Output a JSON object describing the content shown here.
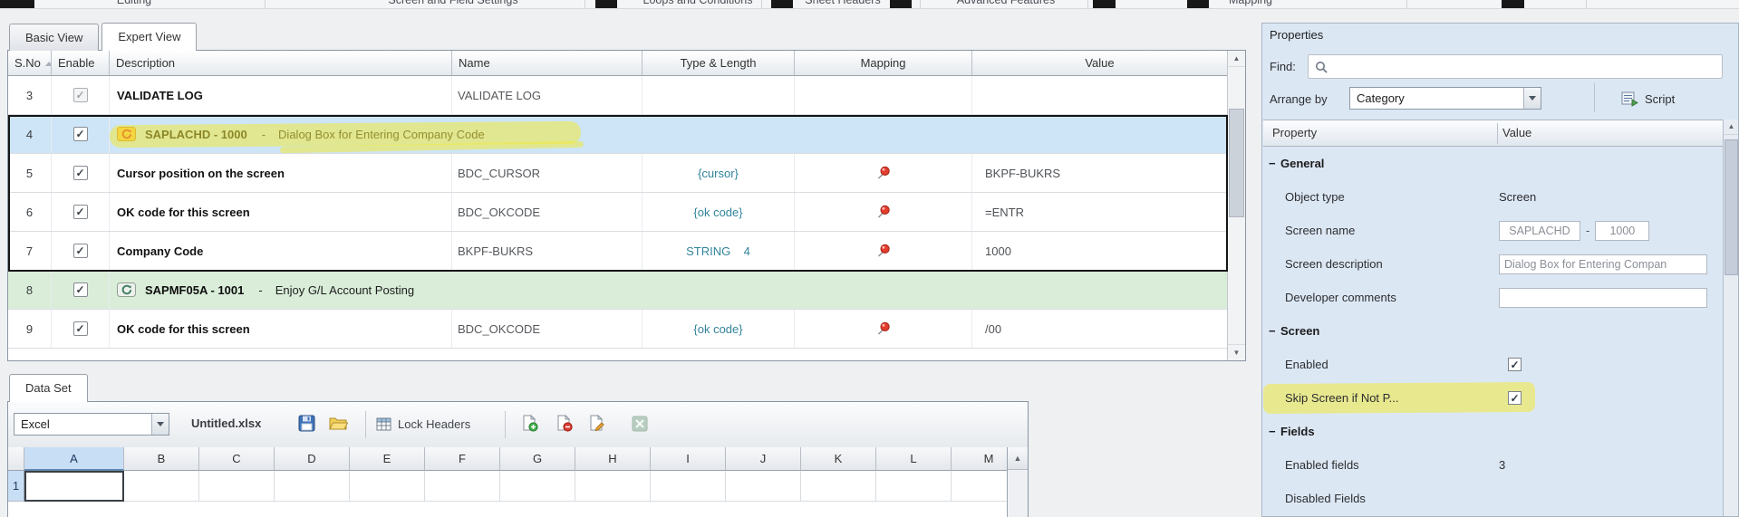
{
  "colors": {
    "accent_teal": "#31849b",
    "selected_row": "#cde5f6",
    "screen_row": "#d9edd9",
    "highlight_yellow": "#f3e93c",
    "pin_red": "#e23d2e"
  },
  "ribbon": {
    "groups": [
      "Editing",
      "Screen and Field Settings",
      "Loops and Conditions",
      "Sheet Headers",
      "Advanced Features",
      "Mapping"
    ]
  },
  "view_tabs": [
    {
      "label": "Basic View",
      "active": false
    },
    {
      "label": "Expert View",
      "active": true
    }
  ],
  "script_table": {
    "columns": [
      "S.No",
      "Enable",
      "Description",
      "Name",
      "Type & Length",
      "Mapping",
      "Value"
    ],
    "rows": [
      {
        "sno": "3",
        "checked": true,
        "check_gray": true,
        "kind": "normal",
        "description": "VALIDATE LOG",
        "name": "VALIDATE LOG",
        "type": "",
        "mapped": false,
        "value": ""
      },
      {
        "sno": "4",
        "checked": true,
        "kind": "screen-selected",
        "icon": "screen-icon-orange",
        "code": "SAPLACHD - 1000",
        "sep": "-",
        "text": "Dialog Box for Entering Company Code",
        "highlighted": true
      },
      {
        "sno": "5",
        "checked": true,
        "kind": "normal",
        "description": "Cursor position on the screen",
        "name": "BDC_CURSOR",
        "type": "{cursor}",
        "mapped": true,
        "value": "BKPF-BUKRS"
      },
      {
        "sno": "6",
        "checked": true,
        "kind": "normal",
        "description": "OK code for this screen",
        "name": "BDC_OKCODE",
        "type": "{ok code}",
        "mapped": true,
        "value": "=ENTR"
      },
      {
        "sno": "7",
        "checked": true,
        "kind": "normal",
        "description": "Company Code",
        "name": "BKPF-BUKRS",
        "type": "STRING    4",
        "mapped": true,
        "value": "1000"
      },
      {
        "sno": "8",
        "checked": true,
        "kind": "screen-green",
        "icon": "screen-icon-green",
        "code": "SAPMF05A - 1001",
        "sep": "-",
        "text": "Enjoy G/L Account Posting"
      },
      {
        "sno": "9",
        "checked": true,
        "kind": "normal",
        "description": "OK code for this screen",
        "name": "BDC_OKCODE",
        "type": "{ok code}",
        "mapped": true,
        "value": "/00"
      }
    ]
  },
  "dataset": {
    "tab_label": "Data Set",
    "source": "Excel",
    "file_name": "Untitled.xlsx",
    "lock_headers": "Lock Headers",
    "toolbar_icons": [
      "save-icon",
      "open-file-icon",
      "lock-headers-icon",
      "add-sheet-icon",
      "remove-sheet-icon",
      "rename-sheet-icon",
      "excel-icon"
    ],
    "columns": [
      "A",
      "B",
      "C",
      "D",
      "E",
      "F",
      "G",
      "H",
      "I",
      "J",
      "K",
      "L",
      "M"
    ],
    "row_labels": [
      "1"
    ]
  },
  "properties": {
    "title": "Properties",
    "find_label": "Find:",
    "arrange_label": "Arrange by",
    "arrange_value": "Category",
    "script_label": "Script",
    "grid_header": {
      "property": "Property",
      "value": "Value"
    },
    "groups": [
      {
        "label": "General",
        "items": [
          {
            "label": "Object type",
            "kind": "text",
            "value": "Screen"
          },
          {
            "label": "Screen name",
            "kind": "dual",
            "value1": "SAPLACHD",
            "sep": "-",
            "value2": "1000"
          },
          {
            "label": "Screen description",
            "kind": "input",
            "value": "Dialog Box for Entering Compan"
          },
          {
            "label": "Developer comments",
            "kind": "input",
            "value": ""
          }
        ]
      },
      {
        "label": "Screen",
        "items": [
          {
            "label": "Enabled",
            "kind": "checkbox",
            "checked": true
          },
          {
            "label": "Skip Screen if Not P...",
            "kind": "checkbox",
            "checked": true,
            "highlighted": true
          }
        ]
      },
      {
        "label": "Fields",
        "items": [
          {
            "label": "Enabled fields",
            "kind": "text",
            "value": "3"
          },
          {
            "label": "Disabled Fields",
            "kind": "text",
            "value": ""
          }
        ]
      }
    ]
  }
}
